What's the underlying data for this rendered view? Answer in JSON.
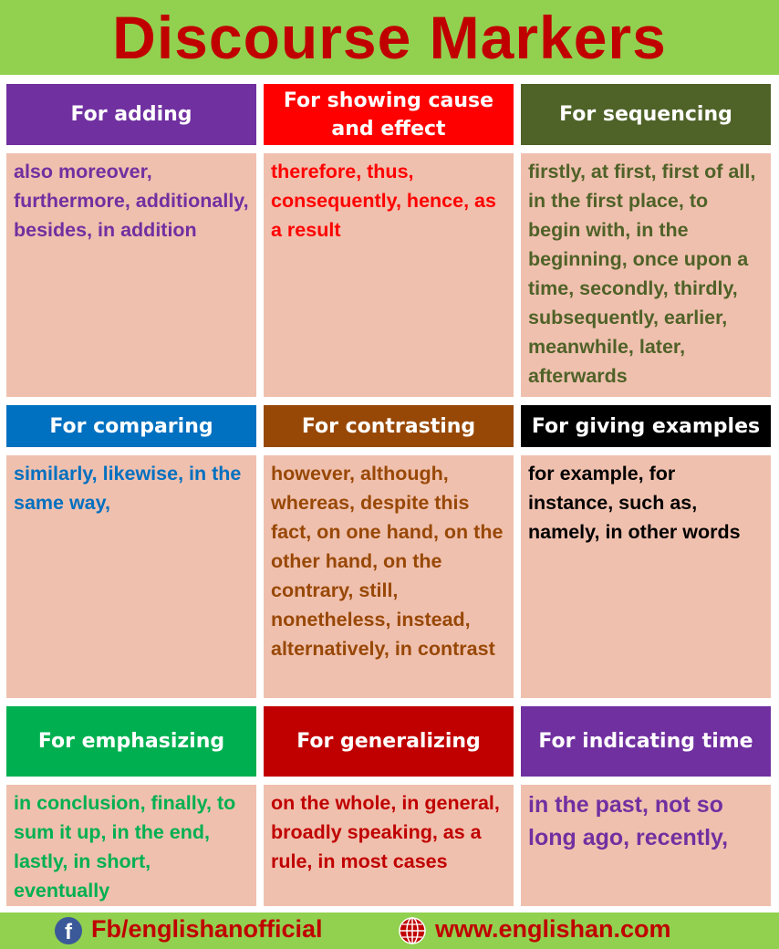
{
  "title": "Discourse Markers",
  "colors": {
    "title_bar": "#92d050",
    "title_text": "#c00000",
    "card_body": "#f0c0ae"
  },
  "cards": [
    {
      "heading": "For adding",
      "header_color": "#7030a0",
      "text_color": "#7030a0",
      "text": "also moreover, furthermore, additionally, besides, in addition"
    },
    {
      "heading": "For showing cause and effect",
      "header_color": "#ff0000",
      "text_color": "#ff0000",
      "text": "therefore, thus, consequently, hence, as a result"
    },
    {
      "heading": "For sequencing",
      "header_color": "#4f6228",
      "text_color": "#4f6228",
      "text": "firstly, at first, first of all, in the first place, to begin with, in the beginning, once upon a time, secondly, thirdly, subsequently, earlier, meanwhile, later, afterwards"
    },
    {
      "heading": "For comparing",
      "header_color": "#0070c0",
      "text_color": "#0070c0",
      "text": "similarly, likewise, in the same way,"
    },
    {
      "heading": "For contrasting",
      "header_color": "#984806",
      "text_color": "#984806",
      "text": "however, although, whereas, despite this fact, on one hand, on the other hand, on the contrary, still, nonetheless, instead, alternatively, in contrast"
    },
    {
      "heading": "For giving examples",
      "header_color": "#000000",
      "text_color": "#000000",
      "text": "for example, for instance, such as, namely, in other words"
    },
    {
      "heading": "For emphasizing",
      "header_color": "#00b050",
      "text_color": "#00b050",
      "text": "in conclusion, finally, to sum it up, in the end, lastly, in short, eventually"
    },
    {
      "heading": "For generalizing",
      "header_color": "#c00000",
      "text_color": "#c00000",
      "text": "on the whole, in general, broadly speaking, as a rule, in most cases"
    },
    {
      "heading": "For indicating time",
      "header_color": "#7030a0",
      "text_color": "#7030a0",
      "text": "in the past, not so long ago, recently,"
    }
  ],
  "footer": {
    "facebook": "Fb/englishanofficial",
    "website": "www.englishan.com",
    "icons": [
      "facebook-icon",
      "globe-icon"
    ]
  }
}
